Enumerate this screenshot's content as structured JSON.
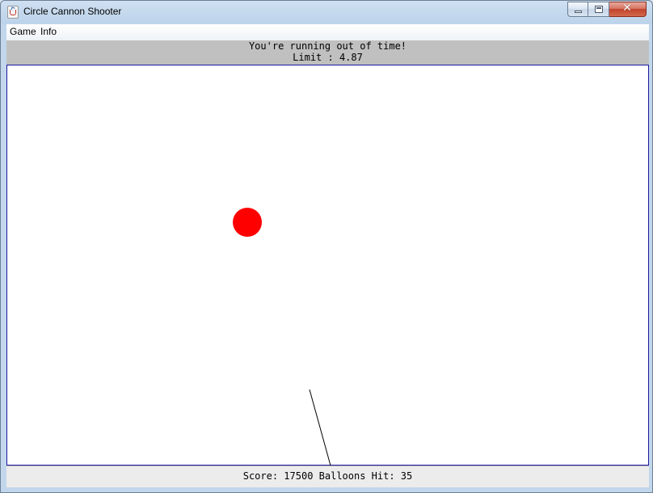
{
  "window": {
    "title": "Circle Cannon Shooter",
    "icon": "java-coffee-icon"
  },
  "controls": {
    "close_glyph": "✕"
  },
  "menu": {
    "items": [
      {
        "label": "Game"
      },
      {
        "label": "Info"
      }
    ]
  },
  "status": {
    "message": "You're running out of time!",
    "limit_text": "Limit : 4.87",
    "background": "#c0c0c0"
  },
  "playfield": {
    "border_color": "#1a1aa0",
    "balloon_color": "#ff0000",
    "cannon_color": "#000000"
  },
  "scoreboard": {
    "text": "Score: 17500 Balloons Hit: 35"
  }
}
